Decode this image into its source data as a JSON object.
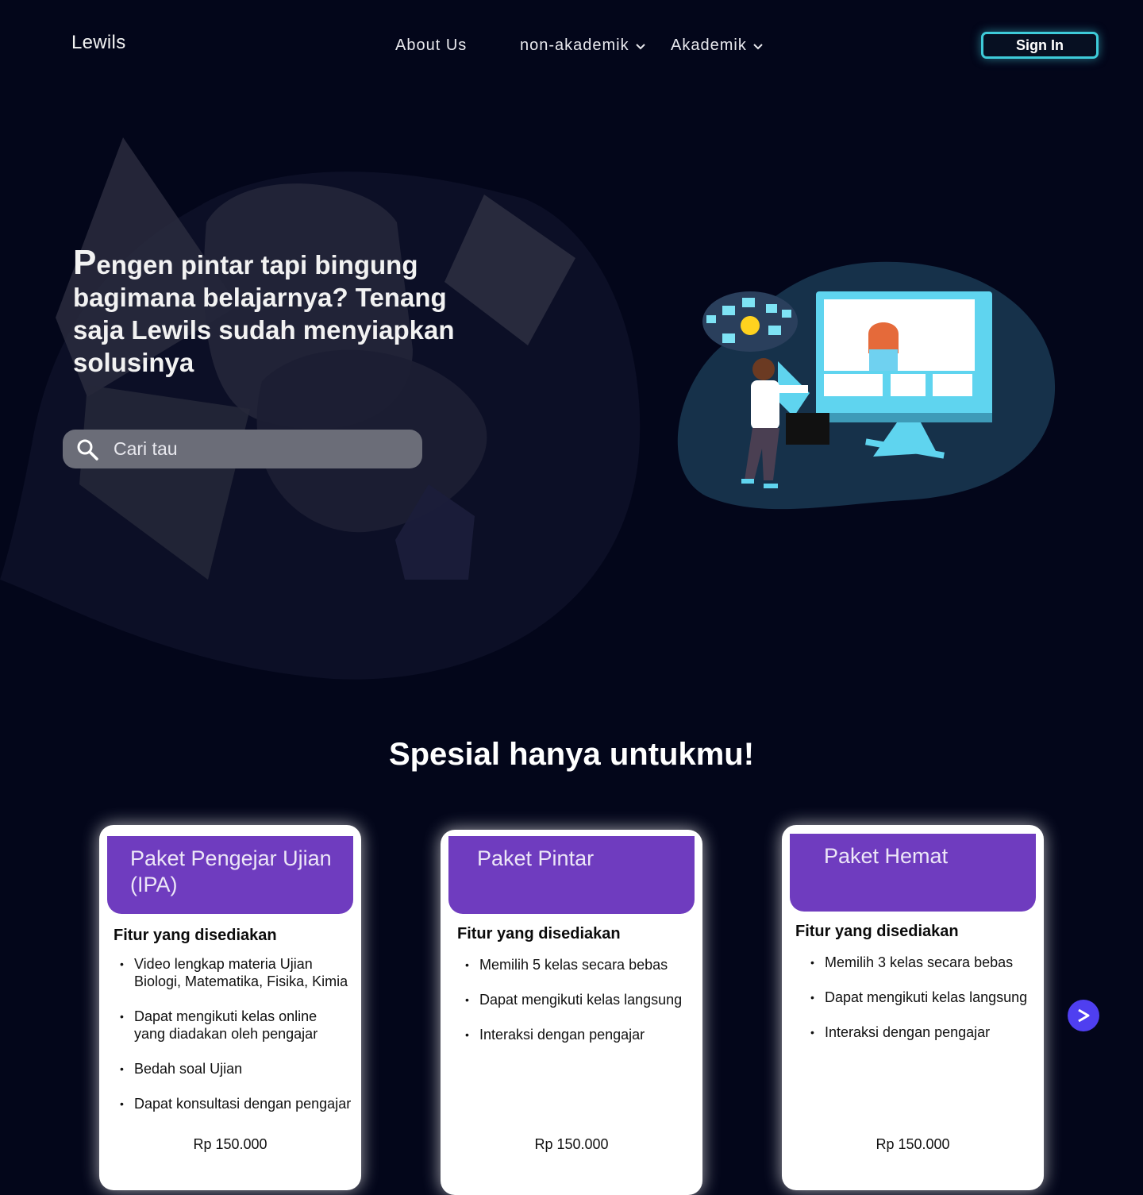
{
  "nav": {
    "logo": "Lewils",
    "links": [
      {
        "label": "About Us"
      },
      {
        "label": "non-akademik"
      },
      {
        "label": "Akademik"
      }
    ],
    "sign_in": "Sign In"
  },
  "hero": {
    "headline_first": "P",
    "headline_rest": "engen pintar tapi bingung bagimana belajarnya? Tenang saja Lewils sudah menyiapkan solusinya",
    "search_placeholder": "Cari tau"
  },
  "section": {
    "title": "Spesial hanya untukmu!"
  },
  "cards": [
    {
      "name": "Paket Pengejar Ujian (IPA)",
      "features_title": "Fitur yang disediakan",
      "features": [
        "Video lengkap materia Ujian Biologi, Matematika, Fisika, Kimia",
        "Dapat mengikuti kelas online yang diadakan oleh pengajar",
        "Bedah soal Ujian",
        "Dapat konsultasi dengan pengajar"
      ],
      "price": "Rp 150.000"
    },
    {
      "name": "Paket Pintar",
      "features_title": "Fitur yang disediakan",
      "features": [
        "Memilih 5 kelas secara bebas",
        "Dapat mengikuti kelas langsung",
        "Interaksi dengan pengajar"
      ],
      "price": "Rp 150.000"
    },
    {
      "name": "Paket Hemat",
      "features_title": "Fitur yang disediakan",
      "features": [
        "Memilih 3 kelas secara bebas",
        "Dapat mengikuti kelas langsung",
        "Interaksi dengan pengajar"
      ],
      "price": "Rp 150.000"
    }
  ],
  "colors": {
    "background": "#03061a",
    "accent_purple": "#6f3cbf",
    "sign_in_border": "#3ecbd9",
    "next_button": "#4f3ff0"
  },
  "icons": {
    "search": "search-icon",
    "dropdown": "chevron-down-icon",
    "next": "arrow-right-icon"
  }
}
